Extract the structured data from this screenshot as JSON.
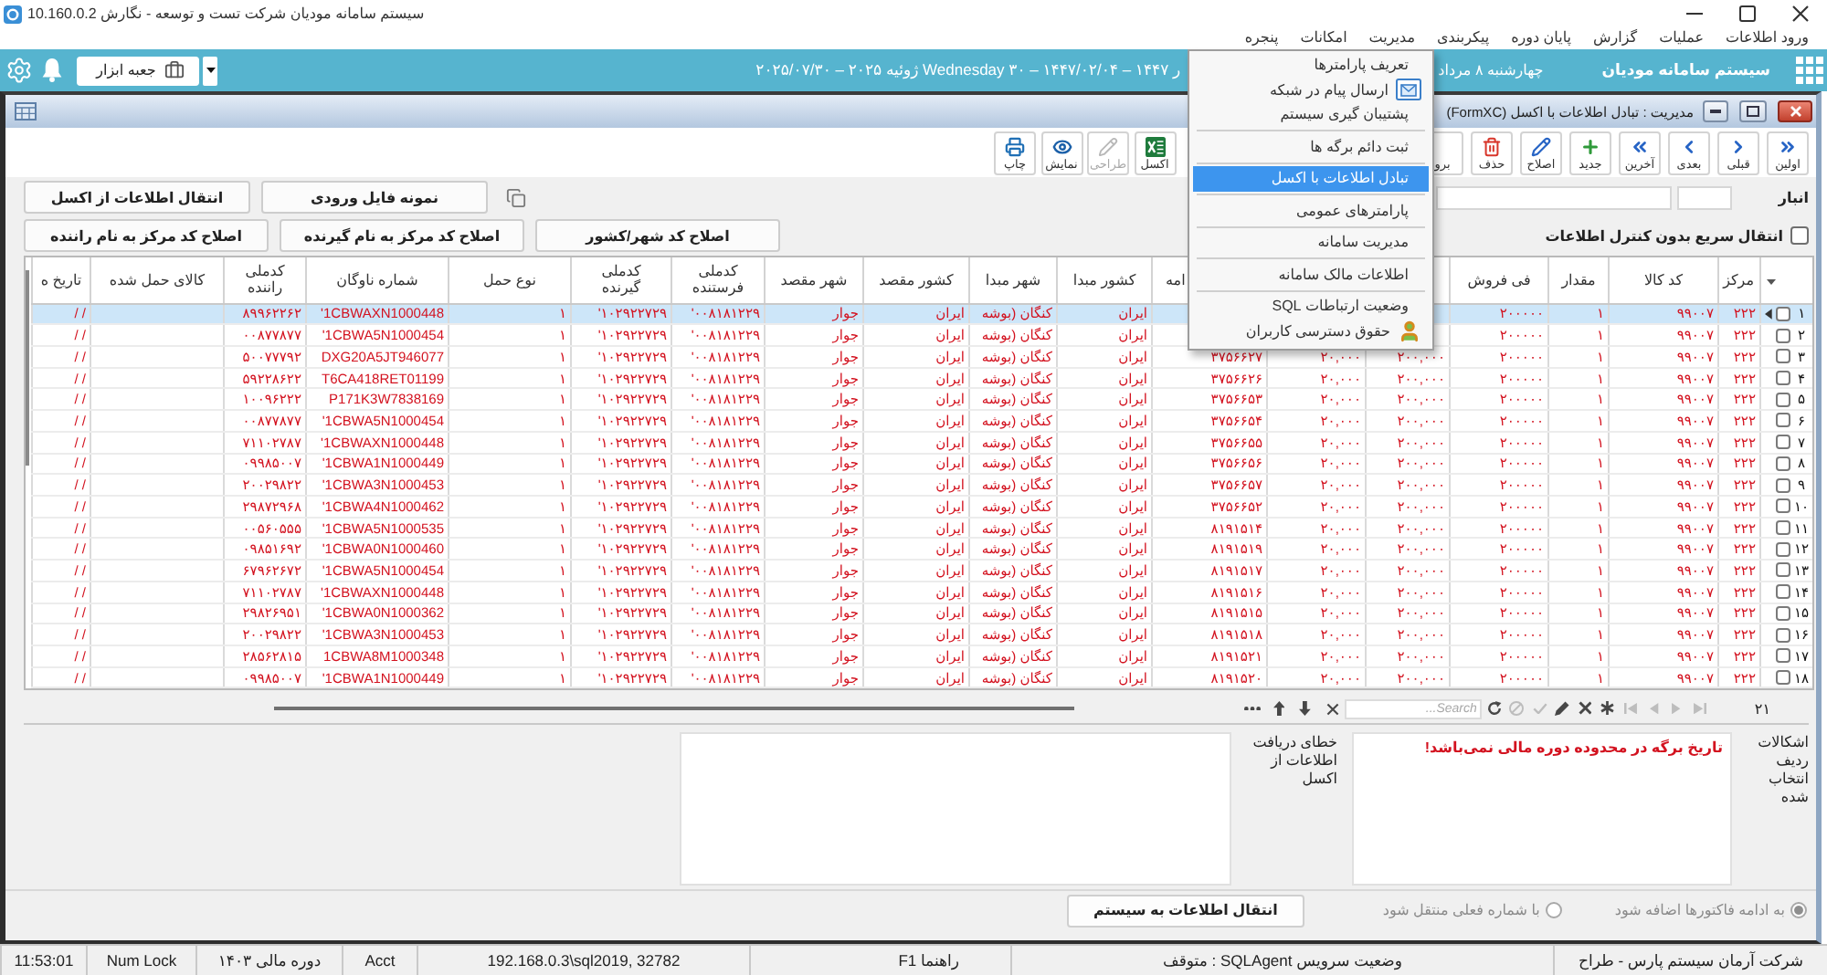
{
  "window": {
    "title": "سیستم سامانه مودیان شرکت تست و توسعه - نگارش 10.160.0.2"
  },
  "menu_bar": [
    "ورود اطلاعات",
    "عملیات",
    "گزارش",
    "پایان دوره",
    "پیکربندی",
    "مدیریت",
    "امکانات",
    "پنجره"
  ],
  "dropdown_menu": [
    {
      "kind": "item",
      "label": "تعریف پارامترها",
      "selected": false
    },
    {
      "kind": "icon_item",
      "label": "ارسال پیام در شبکه",
      "selected": false
    },
    {
      "kind": "item",
      "label": "پشتیبان گیری سیستم",
      "selected": false
    },
    {
      "kind": "separator"
    },
    {
      "kind": "item",
      "label": "ثبت دائم برگه ها",
      "selected": false
    },
    {
      "kind": "separator"
    },
    {
      "kind": "item",
      "label": "تبادل اطلاعات با اکسل",
      "selected": true
    },
    {
      "kind": "separator"
    },
    {
      "kind": "item",
      "label": "پارامترهای عمومی",
      "selected": false
    },
    {
      "kind": "separator"
    },
    {
      "kind": "item",
      "label": "مدیریت سامانه",
      "selected": false
    },
    {
      "kind": "separator"
    },
    {
      "kind": "item",
      "label": "اطلاعات مالک سامانه",
      "selected": false
    },
    {
      "kind": "separator"
    },
    {
      "kind": "item",
      "label": "وضعیت ارتباطات SQL",
      "selected": false
    },
    {
      "kind": "icon_item",
      "label": "حقوق دسترسی کاربران",
      "selected": false
    }
  ],
  "header": {
    "toolbox_button": "جعبه ابزار",
    "date_left": "۲۰۲۵/۰۷/۳۰ – ۲۰۲۵ ژوئیه Wednesday ۳۰ – ۱۴۴۷/۰۲/۰۴ – ۱۴۴۷ ر",
    "date_right": "چهارشنبه ۸ مرداد",
    "system_name": "سیستم سامانه مودیان"
  },
  "form_window": {
    "title": "مدیریت : تبادل اطلاعات با اکسل (FormXC)"
  },
  "toolbar": {
    "record_buttons": [
      {
        "label": "اولین",
        "kind": "first",
        "disabled": false
      },
      {
        "label": "قبلی",
        "kind": "previous",
        "disabled": false
      },
      {
        "label": "بعدی",
        "kind": "next",
        "disabled": false
      },
      {
        "label": "آخرین",
        "kind": "last",
        "disabled": false
      },
      {
        "label": "جدید",
        "kind": "new",
        "disabled": false
      },
      {
        "label": "اصلاح",
        "kind": "edit",
        "disabled": false
      },
      {
        "label": "حذف",
        "kind": "delete",
        "disabled": false
      },
      {
        "label": "برو",
        "kind": "refresh",
        "disabled": false
      }
    ],
    "output_buttons": [
      {
        "label": "اکسل",
        "kind": "excel",
        "disabled": false
      },
      {
        "label": "طراحی",
        "kind": "design",
        "disabled": true
      },
      {
        "label": "نمایش",
        "kind": "view",
        "disabled": false
      },
      {
        "label": "چاپ",
        "kind": "print",
        "disabled": false
      }
    ]
  },
  "warehouse": {
    "label": "انبار"
  },
  "actions": {
    "row_1": [
      "نمونه فایل ورودی",
      "انتقال اطلاعات از اکسل"
    ],
    "row_2": [
      "اصلاح کد شهر/کشور",
      "اصلاح کد مرکز به نام گیرنده",
      "اصلاح کد مرکز به نام راننده"
    ]
  },
  "quick_transfer": {
    "label": "انتقال سریع بدون کنترل اطلاعات",
    "checked": false
  },
  "table": {
    "columns": [
      "مرکز",
      "کد کالا",
      "مقدار",
      "فی فروش",
      null,
      null,
      "امه",
      "کشور مبدا",
      "شهر مبدا",
      "کشور مقصد",
      "شهر مقصد",
      "کدملی فرستنده",
      "کدملی گیرنده",
      "نوع حمل",
      "شماره ناوگان",
      "کدملی راننده",
      "کالای حمل شده",
      "تاریخ ه"
    ],
    "rows": [
      {
        "number": "۱",
        "checked": false,
        "selected": true,
        "cells": [
          "۲۲۲",
          "۹۹۰۰۷",
          "۱",
          "۲۰۰۰۰۰",
          null,
          null,
          null,
          "ایران",
          "کنگان (بوشه",
          "ایران",
          "جوار",
          "'۰۰۸۱۸۱۲۲۹",
          "'۱۰۲۹۲۲۷۲۹",
          "۱",
          "'1CBWAXN1000448",
          "۸۹۹۶۲۲۶۲",
          null,
          "/ /"
        ]
      },
      {
        "number": "۲",
        "checked": false,
        "selected": false,
        "cells": [
          "۲۲۲",
          "۹۹۰۰۷",
          "۱",
          "۲۰۰۰۰۰",
          null,
          null,
          null,
          "ایران",
          "کنگان (بوشه",
          "ایران",
          "جوار",
          "'۰۰۸۱۸۱۲۲۹",
          "'۱۰۲۹۲۲۷۲۹",
          "۱",
          "'1CBWA5N1000454",
          "۰۰۸۷۷۸۷۷",
          null,
          "/ /"
        ]
      },
      {
        "number": "۳",
        "checked": false,
        "selected": false,
        "cells": [
          "۲۲۲",
          "۹۹۰۰۷",
          "۱",
          "۲۰۰۰۰۰",
          "۲۰۰,۰۰۰",
          "۲۰,۰۰۰",
          "۳۷۵۶۶۲۷",
          "ایران",
          "کنگان (بوشه",
          "ایران",
          "جوار",
          "'۰۰۸۱۸۱۲۲۹",
          "'۱۰۲۹۲۲۷۲۹",
          "۱",
          "DXG20A5JT946077",
          "۵۰۰۷۷۷۹۲",
          null,
          "/ /"
        ]
      },
      {
        "number": "۴",
        "checked": false,
        "selected": false,
        "cells": [
          "۲۲۲",
          "۹۹۰۰۷",
          "۱",
          "۲۰۰۰۰۰",
          "۲۰۰,۰۰۰",
          "۲۰,۰۰۰",
          "۳۷۵۶۶۲۶",
          "ایران",
          "کنگان (بوشه",
          "ایران",
          "جوار",
          "'۰۰۸۱۸۱۲۲۹",
          "'۱۰۲۹۲۲۷۲۹",
          "۱",
          "T6CA418RET01199",
          "۵۹۲۲۸۶۲۲",
          null,
          "/ /"
        ]
      },
      {
        "number": "۵",
        "checked": false,
        "selected": false,
        "cells": [
          "۲۲۲",
          "۹۹۰۰۷",
          "۱",
          "۲۰۰۰۰۰",
          "۲۰۰,۰۰۰",
          "۲۰,۰۰۰",
          "۳۷۵۶۶۵۳",
          "ایران",
          "کنگان (بوشه",
          "ایران",
          "جوار",
          "'۰۰۸۱۸۱۲۲۹",
          "'۱۰۲۹۲۲۷۲۹",
          "۱",
          "P171K3W7838169",
          "۱۰۰۹۶۲۲۲",
          null,
          "/ /"
        ]
      },
      {
        "number": "۶",
        "checked": false,
        "selected": false,
        "cells": [
          "۲۲۲",
          "۹۹۰۰۷",
          "۱",
          "۲۰۰۰۰۰",
          "۲۰۰,۰۰۰",
          "۲۰,۰۰۰",
          "۳۷۵۶۶۵۴",
          "ایران",
          "کنگان (بوشه",
          "ایران",
          "جوار",
          "'۰۰۸۱۸۱۲۲۹",
          "'۱۰۲۹۲۲۷۲۹",
          "۱",
          "'1CBWA5N1000454",
          "۰۰۸۷۷۸۷۷",
          null,
          "/ /"
        ]
      },
      {
        "number": "۷",
        "checked": false,
        "selected": false,
        "cells": [
          "۲۲۲",
          "۹۹۰۰۷",
          "۱",
          "۲۰۰۰۰۰",
          "۲۰۰,۰۰۰",
          "۲۰,۰۰۰",
          "۳۷۵۶۶۵۵",
          "ایران",
          "کنگان (بوشه",
          "ایران",
          "جوار",
          "'۰۰۸۱۸۱۲۲۹",
          "'۱۰۲۹۲۲۷۲۹",
          "۱",
          "'1CBWAXN1000448",
          "۷۱۱۰۲۷۸۷",
          null,
          "/ /"
        ]
      },
      {
        "number": "۸",
        "checked": false,
        "selected": false,
        "cells": [
          "۲۲۲",
          "۹۹۰۰۷",
          "۱",
          "۲۰۰۰۰۰",
          "۲۰۰,۰۰۰",
          "۲۰,۰۰۰",
          "۳۷۵۶۶۵۶",
          "ایران",
          "کنگان (بوشه",
          "ایران",
          "جوار",
          "'۰۰۸۱۸۱۲۲۹",
          "'۱۰۲۹۲۲۷۲۹",
          "۱",
          "'1CBWA1N1000449",
          "۰۹۹۸۵۰۰۷",
          null,
          "/ /"
        ]
      },
      {
        "number": "۹",
        "checked": false,
        "selected": false,
        "cells": [
          "۲۲۲",
          "۹۹۰۰۷",
          "۱",
          "۲۰۰۰۰۰",
          "۲۰۰,۰۰۰",
          "۲۰,۰۰۰",
          "۳۷۵۶۶۵۷",
          "ایران",
          "کنگان (بوشه",
          "ایران",
          "جوار",
          "'۰۰۸۱۸۱۲۲۹",
          "'۱۰۲۹۲۲۷۲۹",
          "۱",
          "'1CBWA3N1000453",
          "۲۰۰۲۹۸۲۲",
          null,
          "/ /"
        ]
      },
      {
        "number": "۱۰",
        "checked": false,
        "selected": false,
        "cells": [
          "۲۲۲",
          "۹۹۰۰۷",
          "۱",
          "۲۰۰۰۰۰",
          "۲۰۰,۰۰۰",
          "۲۰,۰۰۰",
          "۳۷۵۶۶۵۲",
          "ایران",
          "کنگان (بوشه",
          "ایران",
          "جوار",
          "'۰۰۸۱۸۱۲۲۹",
          "'۱۰۲۹۲۲۷۲۹",
          "۱",
          "'1CBWA4N1000462",
          "۲۹۸۷۲۹۶۸",
          null,
          "/ /"
        ]
      },
      {
        "number": "۱۱",
        "checked": false,
        "selected": false,
        "cells": [
          "۲۲۲",
          "۹۹۰۰۷",
          "۱",
          "۲۰۰۰۰۰",
          "۲۰۰,۰۰۰",
          "۲۰,۰۰۰",
          "۸۱۹۱۵۱۴",
          "ایران",
          "کنگان (بوشه",
          "ایران",
          "جوار",
          "'۰۰۸۱۸۱۲۲۹",
          "'۱۰۲۹۲۲۷۲۹",
          "۱",
          "'1CBWA5N1000535",
          "۰۰۵۶۰۵۵۵",
          null,
          "/ /"
        ]
      },
      {
        "number": "۱۲",
        "checked": false,
        "selected": false,
        "cells": [
          "۲۲۲",
          "۹۹۰۰۷",
          "۱",
          "۲۰۰۰۰۰",
          "۲۰۰,۰۰۰",
          "۲۰,۰۰۰",
          "۸۱۹۱۵۱۹",
          "ایران",
          "کنگان (بوشه",
          "ایران",
          "جوار",
          "'۰۰۸۱۸۱۲۲۹",
          "'۱۰۲۹۲۲۷۲۹",
          "۱",
          "'1CBWA0N1000460",
          "۰۹۸۵۱۶۹۲",
          null,
          "/ /"
        ]
      },
      {
        "number": "۱۳",
        "checked": false,
        "selected": false,
        "cells": [
          "۲۲۲",
          "۹۹۰۰۷",
          "۱",
          "۲۰۰۰۰۰",
          "۲۰۰,۰۰۰",
          "۲۰,۰۰۰",
          "۸۱۹۱۵۱۷",
          "ایران",
          "کنگان (بوشه",
          "ایران",
          "جوار",
          "'۰۰۸۱۸۱۲۲۹",
          "'۱۰۲۹۲۲۷۲۹",
          "۱",
          "'1CBWA5N1000454",
          "۶۷۹۶۲۶۷۲",
          null,
          "/ /"
        ]
      },
      {
        "number": "۱۴",
        "checked": false,
        "selected": false,
        "cells": [
          "۲۲۲",
          "۹۹۰۰۷",
          "۱",
          "۲۰۰۰۰۰",
          "۲۰۰,۰۰۰",
          "۲۰,۰۰۰",
          "۸۱۹۱۵۱۶",
          "ایران",
          "کنگان (بوشه",
          "ایران",
          "جوار",
          "'۰۰۸۱۸۱۲۲۹",
          "'۱۰۲۹۲۲۷۲۹",
          "۱",
          "'1CBWAXN1000448",
          "۷۱۱۰۲۷۸۷",
          null,
          "/ /"
        ]
      },
      {
        "number": "۱۵",
        "checked": false,
        "selected": false,
        "cells": [
          "۲۲۲",
          "۹۹۰۰۷",
          "۱",
          "۲۰۰۰۰۰",
          "۲۰۰,۰۰۰",
          "۲۰,۰۰۰",
          "۸۱۹۱۵۱۵",
          "ایران",
          "کنگان (بوشه",
          "ایران",
          "جوار",
          "'۰۰۸۱۸۱۲۲۹",
          "'۱۰۲۹۲۲۷۲۹",
          "۱",
          "'1CBWA0N1000362",
          "۲۹۸۲۶۹۵۱",
          null,
          "/ /"
        ]
      },
      {
        "number": "۱۶",
        "checked": false,
        "selected": false,
        "cells": [
          "۲۲۲",
          "۹۹۰۰۷",
          "۱",
          "۲۰۰۰۰۰",
          "۲۰۰,۰۰۰",
          "۲۰,۰۰۰",
          "۸۱۹۱۵۱۸",
          "ایران",
          "کنگان (بوشه",
          "ایران",
          "جوار",
          "'۰۰۸۱۸۱۲۲۹",
          "'۱۰۲۹۲۲۷۲۹",
          "۱",
          "'1CBWA3N1000453",
          "۲۰۰۲۹۸۲۲",
          null,
          "/ /"
        ]
      },
      {
        "number": "۱۷",
        "checked": false,
        "selected": false,
        "cells": [
          "۲۲۲",
          "۹۹۰۰۷",
          "۱",
          "۲۰۰۰۰۰",
          "۲۰۰,۰۰۰",
          "۲۰,۰۰۰",
          "۸۱۹۱۵۲۱",
          "ایران",
          "کنگان (بوشه",
          "ایران",
          "جوار",
          "'۰۰۸۱۸۱۲۲۹",
          "'۱۰۲۹۲۲۷۲۹",
          "۱",
          "1CBWA8M1000348",
          "۲۸۵۶۲۸۱۵",
          null,
          "/ /"
        ]
      },
      {
        "number": "۱۸",
        "checked": false,
        "selected": false,
        "cells": [
          "۲۲۲",
          "۹۹۰۰۷",
          "۱",
          "۲۰۰۰۰۰",
          "۲۰۰,۰۰۰",
          "۲۰,۰۰۰",
          "۸۱۹۱۵۲۰",
          "ایران",
          "کنگان (بوشه",
          "ایران",
          "جوار",
          "'۰۰۸۱۸۱۲۲۹",
          "'۱۰۲۹۲۲۷۲۹",
          "۱",
          "'1CBWA1N1000449",
          "۰۹۹۸۵۰۰۷",
          null,
          "/ /"
        ]
      }
    ]
  },
  "navigator": {
    "count": "۲۱",
    "record_tools": [
      {
        "kind": "skip_right",
        "disabled": true
      },
      {
        "kind": "right",
        "disabled": true
      },
      {
        "kind": "left",
        "disabled": true
      },
      {
        "kind": "skip_left",
        "disabled": true
      },
      {
        "kind": "insert",
        "disabled": false
      },
      {
        "kind": "delete",
        "disabled": false
      },
      {
        "kind": "edit",
        "disabled": false
      },
      {
        "kind": "post",
        "disabled": true
      },
      {
        "kind": "cancel",
        "disabled": true
      },
      {
        "kind": "refresh",
        "disabled": false
      }
    ],
    "search": {
      "placeholder": "Search..."
    },
    "search_tools": [
      {
        "kind": "clear",
        "disabled": false
      },
      {
        "kind": "down",
        "disabled": false
      },
      {
        "kind": "up",
        "disabled": false
      },
      {
        "kind": "more",
        "disabled": false
      }
    ]
  },
  "details": {
    "row_errors": {
      "label": "اشکالات ردیف انتخاب شده",
      "value": "تاریخ برگه در محدوده دوره مالی نمی‌باشد!"
    },
    "import_errors": {
      "label": "خطای دریافت اطلاعات از اکسل"
    }
  },
  "options": {
    "radios": [
      {
        "label": "به ادامه فاکتورها اضافه شود",
        "selected": true,
        "disabled": true
      },
      {
        "label": "با شماره فعلی منتقل شود",
        "selected": false,
        "disabled": true
      }
    ],
    "submit_button": "انتقال اطلاعات به سیستم"
  },
  "status_bar": [
    "شرکت آرمان سیستم پارس - طراح",
    "وضعیت سرویس SQLAgent : متوقف",
    "راهنما F1",
    "192.168.0.3\\sql2019, 32782",
    "Acct",
    "دوره مالی ۱۴۰۳",
    "Num Lock",
    "11:53:01"
  ]
}
